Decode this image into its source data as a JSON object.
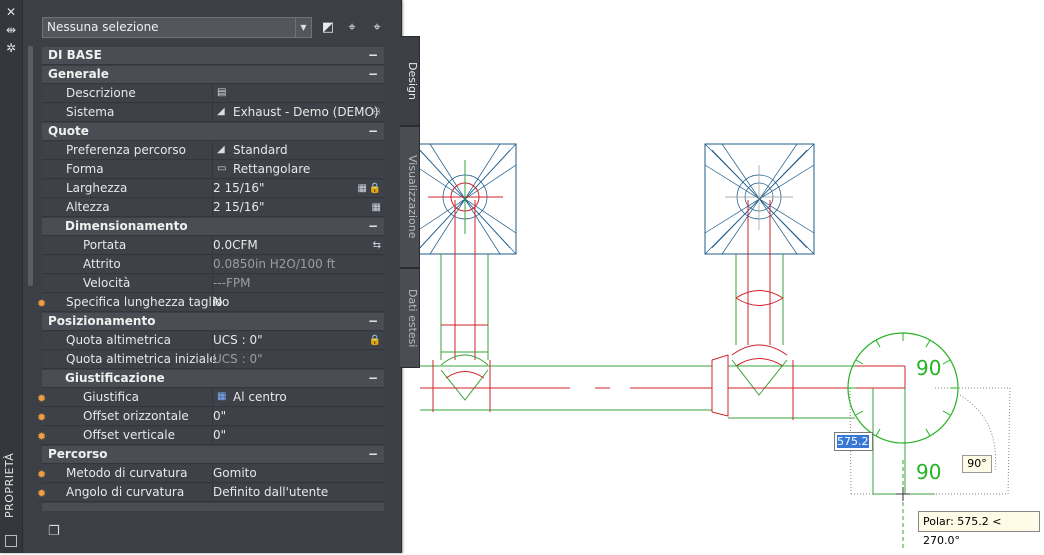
{
  "palette": {
    "title": "PROPRIETÀ",
    "selector": {
      "value": "Nessuna selezione"
    },
    "tabs": [
      "Design",
      "Visualizzazione",
      "Dati estesi"
    ],
    "sections": [
      {
        "type": "header",
        "label": "DI BASE"
      },
      {
        "type": "header",
        "label": "Generale"
      },
      {
        "type": "prop",
        "name": "Descrizione",
        "value": "",
        "icon": "description-table-icon"
      },
      {
        "type": "prop",
        "name": "Sistema",
        "value": "Exhaust - Demo (DEMO)",
        "icon": "duct-system-icon"
      },
      {
        "type": "header",
        "label": "Quote"
      },
      {
        "type": "prop",
        "name": "Preferenza percorso",
        "value": "Standard",
        "icon": "routing-icon"
      },
      {
        "type": "prop",
        "name": "Forma",
        "value": "Rettangolare",
        "icon": "shape-icon"
      },
      {
        "type": "prop",
        "name": "Larghezza",
        "value": "2 15/16\""
      },
      {
        "type": "prop",
        "name": "Altezza",
        "value": "2 15/16\""
      },
      {
        "type": "subheader",
        "label": "Dimensionamento"
      },
      {
        "type": "prop",
        "name": "Portata",
        "value": "0.0CFM"
      },
      {
        "type": "prop",
        "name": "Attrito",
        "value": "0.0850in H2O/100 ft"
      },
      {
        "type": "prop",
        "name": "Velocità",
        "value": "---FPM"
      },
      {
        "type": "prop",
        "name": "Specifica lunghezza taglio",
        "value": "No"
      },
      {
        "type": "header",
        "label": "Posizionamento"
      },
      {
        "type": "prop",
        "name": "Quota altimetrica",
        "value": "UCS : 0\""
      },
      {
        "type": "prop",
        "name": "Quota altimetrica iniziale",
        "value": "UCS : 0\""
      },
      {
        "type": "subheader",
        "label": "Giustificazione"
      },
      {
        "type": "prop",
        "name": "Giustifica",
        "value": "Al centro",
        "icon": "justify-grid-icon"
      },
      {
        "type": "prop",
        "name": "Offset orizzontale",
        "value": "0\""
      },
      {
        "type": "prop",
        "name": "Offset verticale",
        "value": "0\""
      },
      {
        "type": "header",
        "label": "Percorso"
      },
      {
        "type": "prop",
        "name": "Metodo di curvatura",
        "value": "Gomito"
      },
      {
        "type": "prop",
        "name": "Angolo di curvatura",
        "value": "Definito dall'utente"
      }
    ]
  },
  "drawing": {
    "dim_input": "575.2",
    "angle_tip": "90°",
    "polar_tip": "Polar: 575.2 < 270.0°",
    "angle_labels": [
      "90",
      "90"
    ],
    "colors": {
      "duct": "#d0232a",
      "green": "#3aa03a",
      "blue": "#1f5c8a",
      "glyph": "#25b325"
    }
  }
}
